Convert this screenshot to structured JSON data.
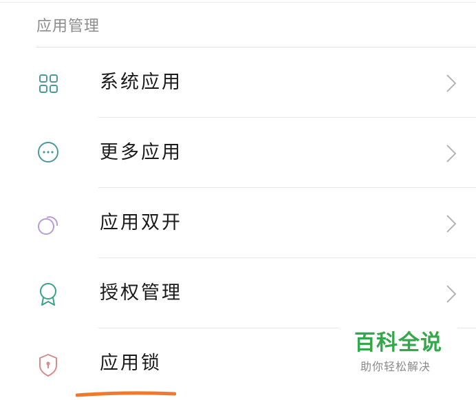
{
  "section": {
    "title": "应用管理"
  },
  "items": [
    {
      "label": "系统应用",
      "icon": "grid-icon",
      "icon_color": "#4a9a9a",
      "has_chevron": true
    },
    {
      "label": "更多应用",
      "icon": "more-dots-icon",
      "icon_color": "#4a9a9a",
      "has_chevron": true
    },
    {
      "label": "应用双开",
      "icon": "dual-circles-icon",
      "icon_color": "#b89ad8",
      "has_chevron": true
    },
    {
      "label": "授权管理",
      "icon": "award-ribbon-icon",
      "icon_color": "#3aa08a",
      "has_chevron": true
    },
    {
      "label": "应用锁",
      "icon": "shield-lock-icon",
      "icon_color": "#d98a8a",
      "has_chevron": false
    }
  ],
  "watermark": {
    "title": "百科全说",
    "subtitle": "助你轻松解决",
    "color": "#33a84a"
  },
  "colors": {
    "chevron": "#b4b4b4",
    "highlight_underline": "#f07a2a"
  }
}
